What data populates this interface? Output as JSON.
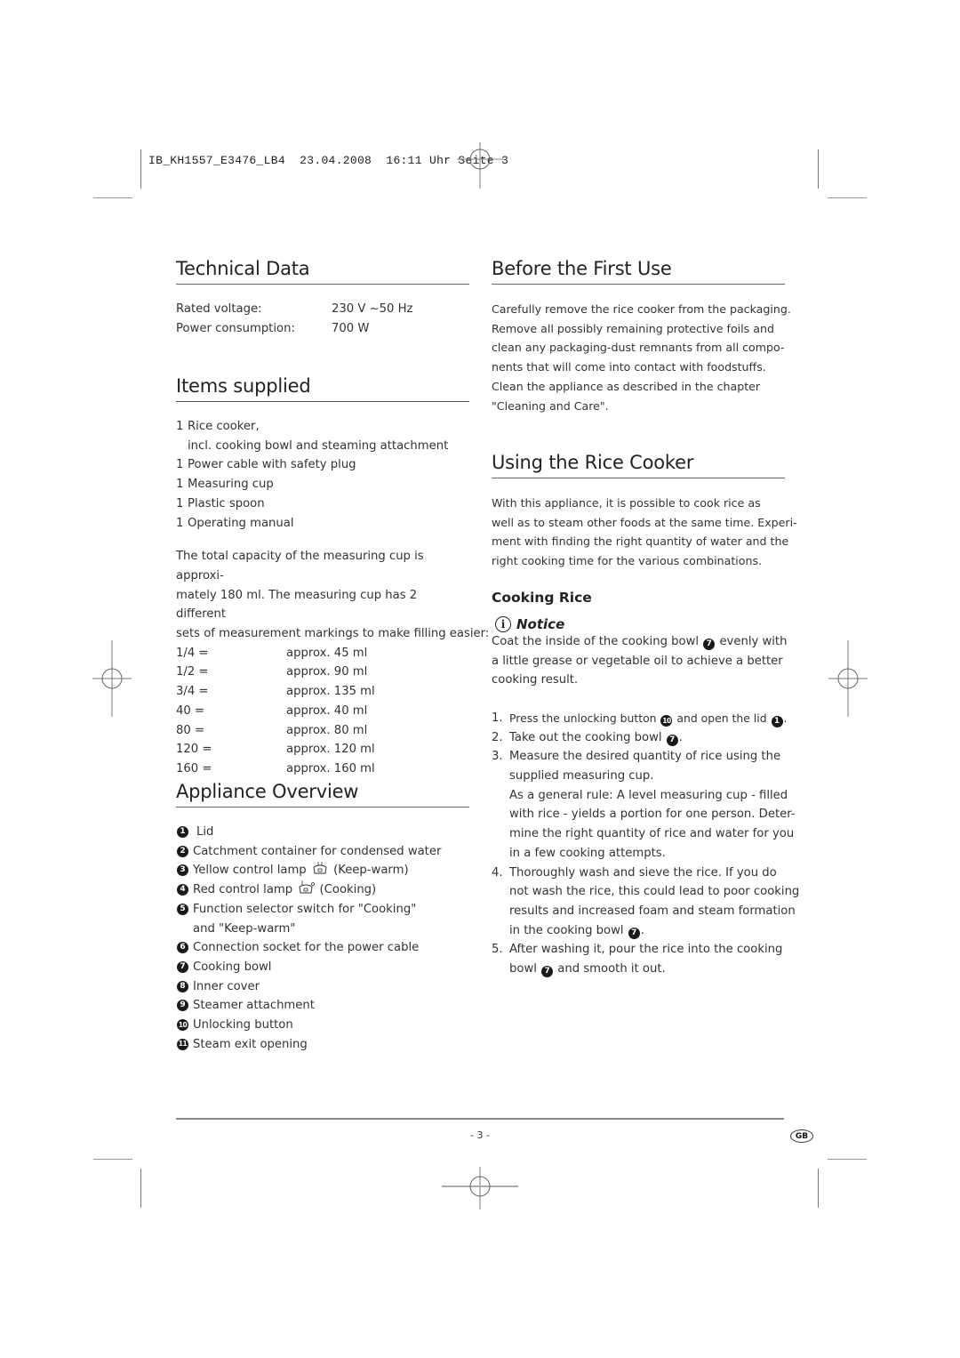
{
  "print_header": {
    "job": "IB_KH1557_E3476_LB4",
    "date": "23.04.2008",
    "time": "16:11 Uhr",
    "page": "Seite 3"
  },
  "technical_data": {
    "title": "Technical Data",
    "rows": [
      {
        "label": "Rated voltage:",
        "value": "230 V ~50 Hz"
      },
      {
        "label": "Power consumption:",
        "value": "700 W"
      }
    ]
  },
  "items_supplied": {
    "title": "Items supplied",
    "items": [
      {
        "qty": "1",
        "text": "Rice cooker,"
      },
      {
        "qty": "",
        "text": "incl. cooking bowl and steaming attachment"
      },
      {
        "qty": "1",
        "text": "Power cable with safety plug"
      },
      {
        "qty": "1",
        "text": "Measuring cup"
      },
      {
        "qty": "1",
        "text": "Plastic spoon"
      },
      {
        "qty": "1",
        "text": "Operating manual"
      }
    ],
    "capacity_text": "The total capacity of the measuring cup is approxi-mately 180 ml. The measuring cup has 2 different sets of measurement markings to make filling easier:",
    "capacity_lines": [
      "The total capacity of the measuring cup is approxi-",
      "mately 180 ml. The measuring cup has 2 different",
      "sets of measurement markings to make filling easier:"
    ],
    "markings": [
      {
        "mark": "1/4 =",
        "value": "approx. 45 ml"
      },
      {
        "mark": "1/2 =",
        "value": "approx. 90 ml"
      },
      {
        "mark": "3/4 =",
        "value": "approx. 135 ml"
      },
      {
        "mark": "40 =",
        "value": "approx. 40 ml"
      },
      {
        "mark": "80 =",
        "value": "approx. 80 ml"
      },
      {
        "mark": "120 =",
        "value": "approx. 120 ml"
      },
      {
        "mark": "160 =",
        "value": "approx. 160 ml"
      }
    ]
  },
  "appliance_overview": {
    "title": "Appliance Overview",
    "items": [
      {
        "num": "1",
        "text": "Lid"
      },
      {
        "num": "2",
        "text": "Catchment container for condensed water"
      },
      {
        "num": "3",
        "text": "Yellow control lamp",
        "icon": "keep-warm-pot-icon",
        "suffix": "(Keep-warm)"
      },
      {
        "num": "4",
        "text": "Red control lamp",
        "icon": "cooking-pot-icon",
        "suffix": "(Cooking)"
      },
      {
        "num": "5",
        "text": "Function selector switch for \"Cooking\"",
        "text2": "and \"Keep-warm\""
      },
      {
        "num": "6",
        "text": "Connection socket for the power cable"
      },
      {
        "num": "7",
        "text": "Cooking bowl"
      },
      {
        "num": "8",
        "text": "Inner cover"
      },
      {
        "num": "9",
        "text": "Steamer attachment"
      },
      {
        "num": "10",
        "text": "Unlocking button"
      },
      {
        "num": "11",
        "text": "Steam exit opening"
      }
    ]
  },
  "before_first_use": {
    "title": "Before the First Use",
    "lines": [
      "Carefully remove the rice cooker from the packaging.",
      "Remove all possibly remaining protective foils and",
      "clean any packaging-dust remnants from all compo-",
      "nents that will come into contact with foodstuffs.",
      "Clean the appliance as described in the chapter",
      "\"Cleaning and Care\"."
    ]
  },
  "using_rice_cooker": {
    "title": "Using the Rice Cooker",
    "lines": [
      "With this appliance, it is possible to cook rice as",
      "well as to steam other foods at the same time. Experi-",
      "ment with finding the right quantity of water and the",
      "right cooking time for the various combinations."
    ],
    "subtitle": "Cooking Rice",
    "notice": {
      "label": "Notice",
      "line1_a": "Coat the inside of the cooking bowl",
      "line1_ref": "7",
      "line1_b": "evenly with",
      "line2": "a little grease or vegetable oil to achieve a better",
      "line3": "cooking result."
    },
    "steps": [
      {
        "n": "1.",
        "parts": [
          "Press the unlocking button",
          "10",
          "and open the lid",
          "1",
          "."
        ]
      },
      {
        "n": "2.",
        "parts": [
          "Take out the cooking bowl",
          "7",
          "."
        ]
      },
      {
        "n": "3.",
        "lines": [
          "Measure the desired quantity of rice using the",
          "supplied measuring cup.",
          "As a general rule: A level measuring cup - filled",
          "with rice - yields a portion for one person. Deter-",
          "mine the right quantity of rice and water for you",
          "in a few cooking attempts."
        ]
      },
      {
        "n": "4.",
        "lines": [
          "Thoroughly wash and sieve the rice. If you do",
          "not wash the rice, this could lead to poor cooking",
          "results and increased foam and steam formation"
        ],
        "last_a": "in the cooking bowl",
        "last_ref": "7",
        "last_b": "."
      },
      {
        "n": "5.",
        "line1": "After washing it, pour the rice into the cooking",
        "last_a": "bowl",
        "last_ref": "7",
        "last_b": "and smooth it out."
      }
    ]
  },
  "footer": {
    "page_number": "- 3 -",
    "language_badge": "GB"
  }
}
